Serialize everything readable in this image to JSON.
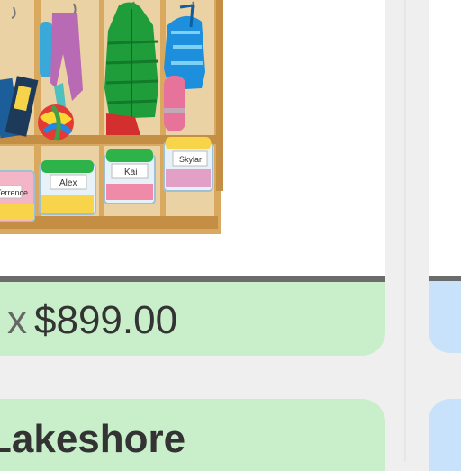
{
  "product": {
    "quantity_prefix": "x",
    "price": "$899.00",
    "brand_label": "Lakeshore",
    "image_labels": [
      "Terrence",
      "Alex",
      "Kai",
      "Skylar"
    ]
  },
  "colors": {
    "price_band": "#c9efca",
    "side_band": "#c8e2fb",
    "image_border": "#6b6b6b"
  }
}
